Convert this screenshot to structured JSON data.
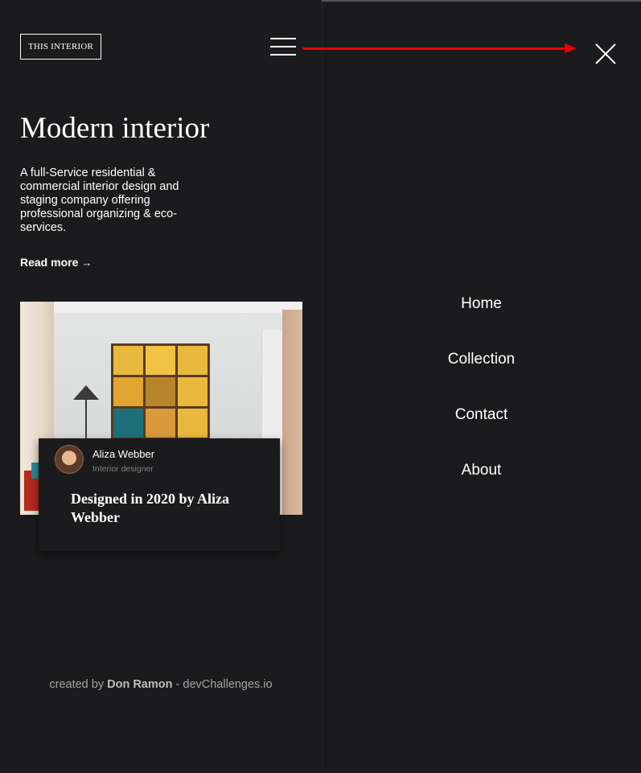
{
  "brand": {
    "logo_text": "THIS INTERIOR"
  },
  "hero": {
    "title": "Modern interior",
    "description": "A full-Service residential & commercial interior design and staging company offering professional organizing & eco-services.",
    "read_more_label": "Read more",
    "read_more_arrow": "→"
  },
  "card": {
    "author_name": "Aliza Webber",
    "author_role": "Interior designer",
    "title": "Designed in 2020 by Aliza Webber"
  },
  "footer": {
    "prefix": "created by",
    "author": "Don Ramon",
    "separator": " - ",
    "site": "devChallenges.io"
  },
  "nav": {
    "items": [
      {
        "label": "Home"
      },
      {
        "label": "Collection"
      },
      {
        "label": "Contact"
      },
      {
        "label": "About"
      }
    ]
  },
  "colors": {
    "background": "#1b1b1d",
    "annotation_arrow": "#ee0000",
    "muted_text": "#828282"
  },
  "icons": [
    "hamburger-menu-icon",
    "close-icon",
    "arrow-right-icon"
  ]
}
